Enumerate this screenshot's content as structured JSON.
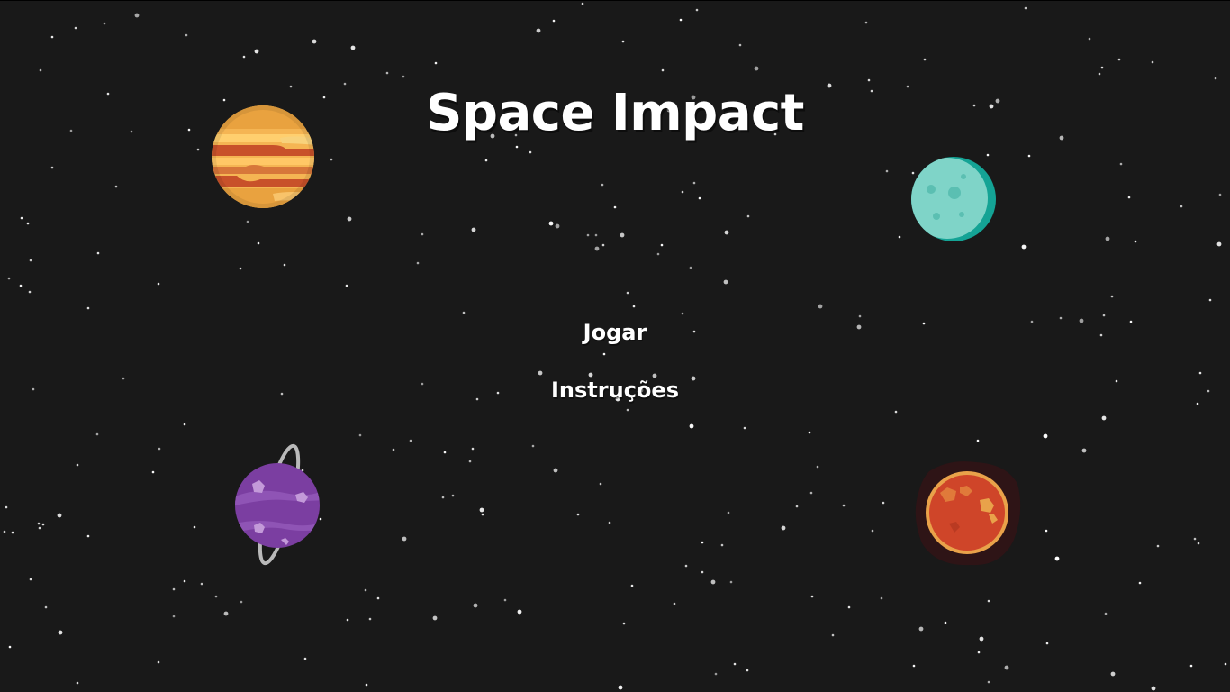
{
  "game": {
    "title": "Space Impact"
  },
  "menu": {
    "items": [
      {
        "label": "Jogar"
      },
      {
        "label": "Instruções"
      }
    ]
  },
  "colors": {
    "background": "#191919",
    "text": "#ffffff",
    "star": "#ffffff"
  },
  "planets": [
    {
      "name": "striped-planet-icon",
      "color": "#f5b04c"
    },
    {
      "name": "moon-planet-icon",
      "color": "#7ed3c8"
    },
    {
      "name": "ringed-planet-icon",
      "color": "#7a3fa0"
    },
    {
      "name": "red-planet-icon",
      "color": "#d4462a"
    }
  ]
}
